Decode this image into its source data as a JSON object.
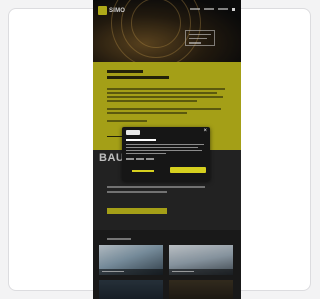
{
  "site": {
    "logo_text": "SIMO",
    "hero_heading": "",
    "big_word": "BAU",
    "section_heading": "",
    "dark_text": "",
    "cta_label": "",
    "projects_label": ""
  },
  "cookie_modal": {
    "title": "",
    "close_glyph": "×",
    "decline_label": "",
    "accept_label": ""
  },
  "colors": {
    "accent_yellow": "#c8c21d",
    "dark_bg": "#1c1c1c",
    "card_bg": "#ffffff"
  }
}
